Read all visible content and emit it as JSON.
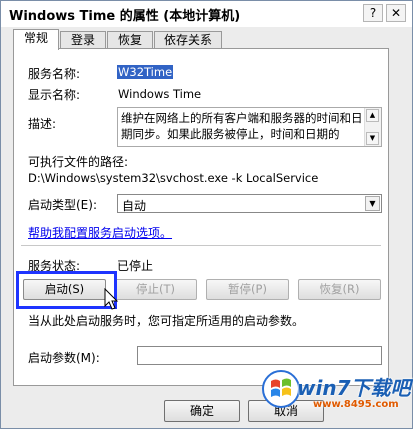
{
  "window": {
    "title": "Windows Time 的属性 (本地计算机)",
    "help_glyph": "?",
    "close_glyph": "✕"
  },
  "tabs": [
    {
      "label": "常规",
      "active": true
    },
    {
      "label": "登录",
      "active": false
    },
    {
      "label": "恢复",
      "active": false
    },
    {
      "label": "依存关系",
      "active": false
    }
  ],
  "general": {
    "service_name_label": "服务名称:",
    "service_name_value": "W32Time",
    "display_name_label": "显示名称:",
    "display_name_value": "Windows Time",
    "description_label": "描述:",
    "description_value": "维护在网络上的所有客户端和服务器的时间和日期同步。如果此服务被停止，时间和日期的",
    "path_label": "可执行文件的路径:",
    "path_value": "D:\\Windows\\system32\\svchost.exe -k LocalService",
    "startup_type_label": "启动类型(E):",
    "startup_type_value": "自动",
    "help_link": "帮助我配置服务启动选项。",
    "status_label": "服务状态:",
    "status_value": "已停止",
    "buttons": {
      "start": "启动(S)",
      "stop": "停止(T)",
      "pause": "暂停(P)",
      "resume": "恢复(R)"
    },
    "hint": "当从此处启动服务时，您可指定所适用的启动参数。",
    "params_label": "启动参数(M):",
    "params_value": ""
  },
  "footer": {
    "ok": "确定",
    "cancel": "取消"
  },
  "watermark": {
    "brand": "win7下载吧",
    "url": "www.8495.com"
  },
  "colors": {
    "highlight_box": "#1e34ff",
    "selection": "#3163c5",
    "link": "#0000ee"
  },
  "icons": [
    "help-icon",
    "close-icon",
    "scroll-up-icon",
    "scroll-down-icon",
    "dropdown-arrow-icon",
    "mouse-cursor-icon",
    "win7-logo-icon"
  ]
}
